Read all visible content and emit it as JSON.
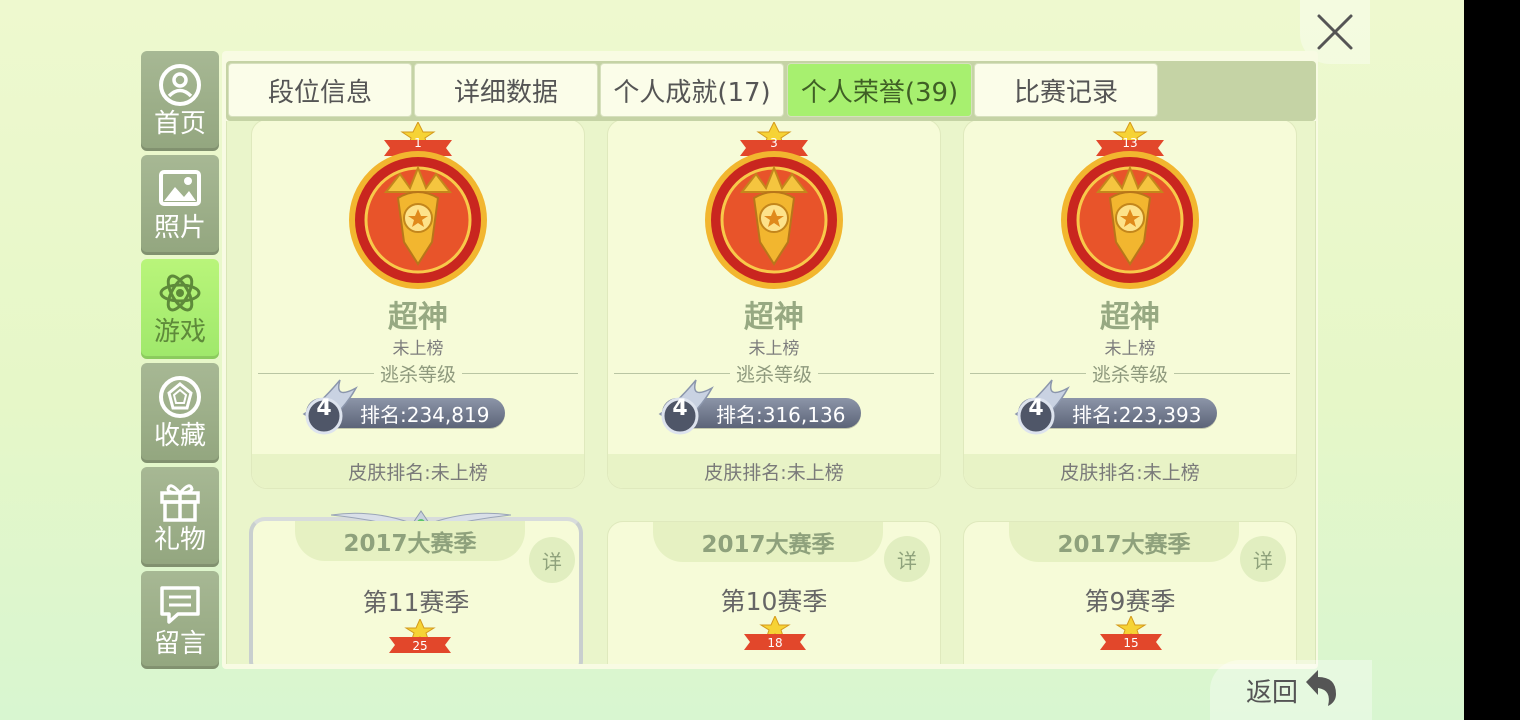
{
  "sidebar": {
    "items": [
      {
        "label": "首页",
        "icon": "home-user-icon"
      },
      {
        "label": "照片",
        "icon": "photo-icon"
      },
      {
        "label": "游戏",
        "icon": "atom-icon",
        "active": true
      },
      {
        "label": "收藏",
        "icon": "gem-icon"
      },
      {
        "label": "礼物",
        "icon": "gift-icon"
      },
      {
        "label": "留言",
        "icon": "message-icon"
      }
    ]
  },
  "tabs": [
    {
      "label": "段位信息"
    },
    {
      "label": "详细数据"
    },
    {
      "label": "个人成就(17)"
    },
    {
      "label": "个人荣誉(39)",
      "active": true
    },
    {
      "label": "比赛记录"
    }
  ],
  "honor_cards": [
    {
      "medal_no": "1",
      "title": "超神",
      "status": "未上榜",
      "category": "逃杀等级",
      "level": "4",
      "rank": "排名:234,819",
      "skin_rank": "皮肤排名:未上榜"
    },
    {
      "medal_no": "3",
      "title": "超神",
      "status": "未上榜",
      "category": "逃杀等级",
      "level": "4",
      "rank": "排名:316,136",
      "skin_rank": "皮肤排名:未上榜"
    },
    {
      "medal_no": "13",
      "title": "超神",
      "status": "未上榜",
      "category": "逃杀等级",
      "level": "4",
      "rank": "排名:223,393",
      "skin_rank": "皮肤排名:未上榜"
    }
  ],
  "season_cards": [
    {
      "year": "2017大赛季",
      "detail": "详",
      "season": "第11赛季",
      "medal_no": "25"
    },
    {
      "year": "2017大赛季",
      "detail": "详",
      "season": "第10赛季",
      "medal_no": "18"
    },
    {
      "year": "2017大赛季",
      "detail": "详",
      "season": "第9赛季",
      "medal_no": "15"
    }
  ],
  "footer": {
    "back_label": "返回"
  },
  "colors": {
    "accent": "#a7f06f",
    "sidebar": "#9fb18a",
    "medal_gold": "#f2b62f",
    "medal_red": "#c9261f"
  }
}
